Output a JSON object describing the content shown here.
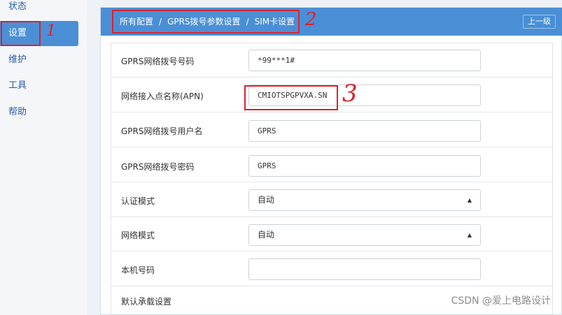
{
  "sidebar": {
    "items": [
      {
        "label": "状态"
      },
      {
        "label": "设置"
      },
      {
        "label": "维护"
      },
      {
        "label": "工具"
      },
      {
        "label": "帮助"
      }
    ]
  },
  "breadcrumb": {
    "root": "所有配置",
    "sep": "/",
    "level2": "GPRS拨号参数设置",
    "level3": "SIM卡设置"
  },
  "back_label": "上一级",
  "annotations": {
    "one": "1",
    "two": "2",
    "three": "3"
  },
  "form": {
    "rows": [
      {
        "label": "GPRS网络拨号号码",
        "value": "*99***1#"
      },
      {
        "label": "网络接入点名称(APN)",
        "value": "CMIOTSPGPVXA.SN"
      },
      {
        "label": "GPRS网络拨号用户名",
        "value": "GPRS"
      },
      {
        "label": "GPRS网络拨号密码",
        "value": "GPRS"
      },
      {
        "label": "认证模式",
        "value": "自动"
      },
      {
        "label": "网络模式",
        "value": "自动"
      },
      {
        "label": "本机号码",
        "value": ""
      },
      {
        "label": "默认承载设置"
      }
    ]
  },
  "watermark": "CSDN @爱上电路设计",
  "colors": {
    "accent": "#4a8fd6",
    "annotation": "#e0202a"
  }
}
